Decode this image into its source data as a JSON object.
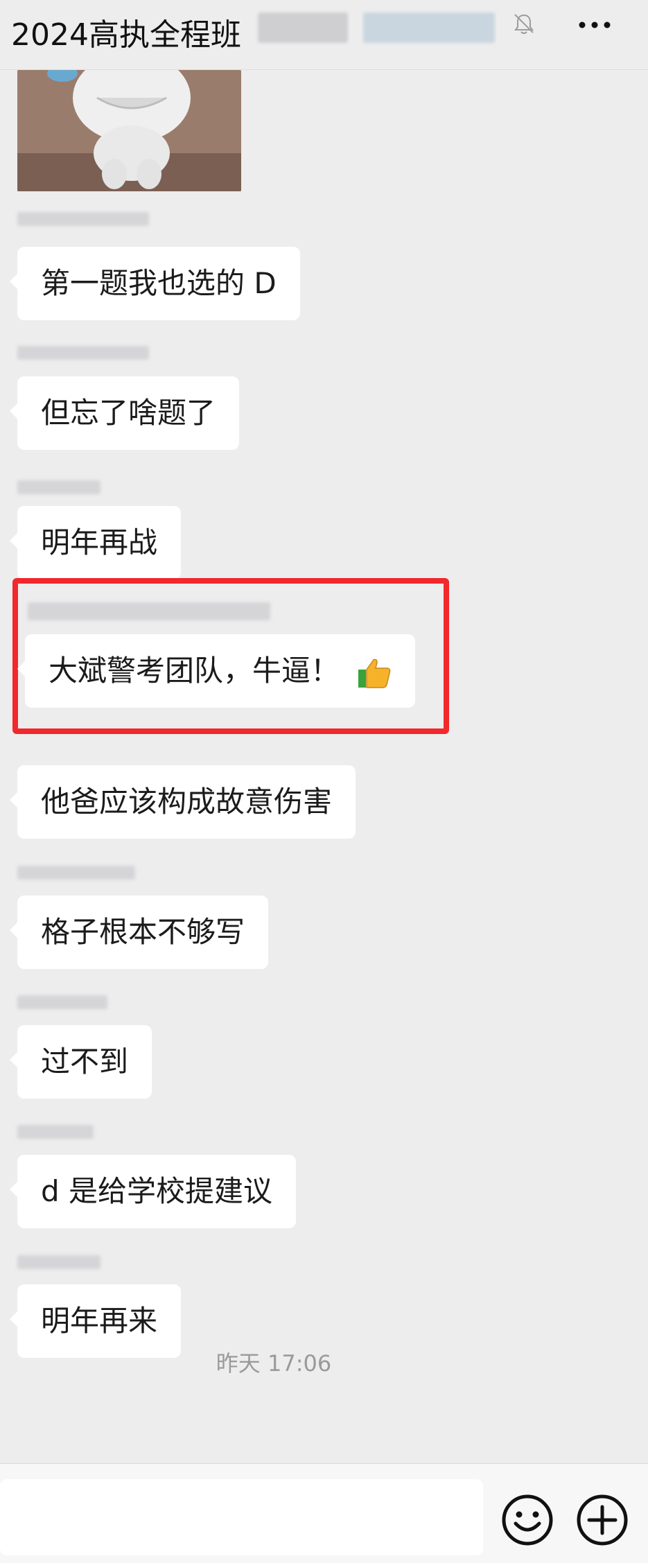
{
  "header": {
    "title": "2024高执全程班"
  },
  "messages": [
    {
      "text": "第一题我也选的 D"
    },
    {
      "text": "但忘了啥题了"
    },
    {
      "text": "明年再战"
    },
    {
      "text": "大斌警考团队，牛逼！"
    },
    {
      "text": "他爸应该构成故意伤害"
    },
    {
      "text": "格子根本不够写"
    },
    {
      "text": "过不到"
    },
    {
      "text": "d 是给学校提建议"
    },
    {
      "text": "明年再来"
    }
  ],
  "timestamp": "昨天 17:06",
  "colors": {
    "background": "#ededed",
    "bubble": "#ffffff",
    "highlight_border": "#f1282c"
  },
  "icons": {
    "mute": "bell-off-icon",
    "more": "more-dots-icon",
    "emoji": "emoji-icon",
    "add": "plus-circle-icon",
    "thumbs_up": "thumbs-up-icon"
  }
}
